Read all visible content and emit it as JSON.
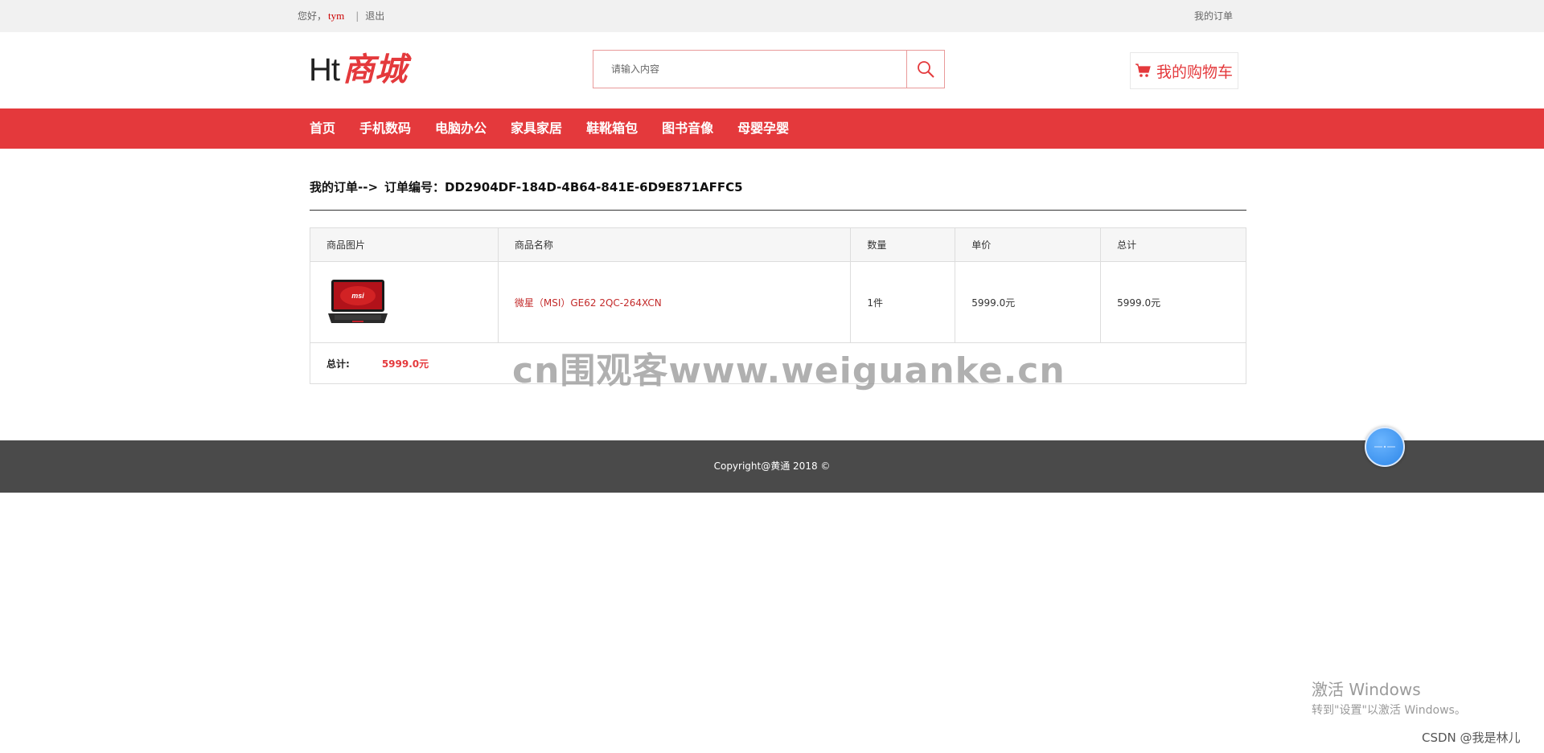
{
  "topbar": {
    "greeting": "您好，",
    "username": "tym",
    "separator": "|",
    "logout": "退出",
    "my_orders": "我的订单"
  },
  "header": {
    "logo_latin": "Ht",
    "logo_cn": "商城",
    "search_placeholder": "请输入内容",
    "cart_label": "我的购物车"
  },
  "nav": {
    "items": [
      "首页",
      "手机数码",
      "电脑办公",
      "家具家居",
      "鞋靴箱包",
      "图书音像",
      "母婴孕婴"
    ]
  },
  "main": {
    "crumb_prefix": "我的订单-->",
    "order_label_and_code": "订单编号：DD2904DF-184D-4B64-841E-6D9E871AFFC5",
    "table": {
      "headers": [
        "商品图片",
        "商品名称",
        "数量",
        "单价",
        "总计"
      ],
      "rows": [
        {
          "name": "微星（MSI）GE62 2QC-264XCN",
          "qty": "1件",
          "price": "5999.0元",
          "total": "5999.0元"
        }
      ],
      "total_label": "总计:",
      "total_value": "5999.0元"
    }
  },
  "footer": {
    "copyright": "Copyright@黄通 2018 ©"
  },
  "overlays": {
    "watermark": "cn围观客www.weiguanke.cn",
    "win_title": "激活 Windows",
    "win_sub": "转到\"设置\"以激活 Windows。",
    "csdn": "CSDN @我是林儿"
  },
  "colors": {
    "brand_red": "#e4393c",
    "footer_bg": "#4a4a4a",
    "topbar_bg": "#f1f1f1"
  },
  "icons": [
    "search-icon",
    "cart-icon",
    "product-image",
    "float-icon"
  ]
}
